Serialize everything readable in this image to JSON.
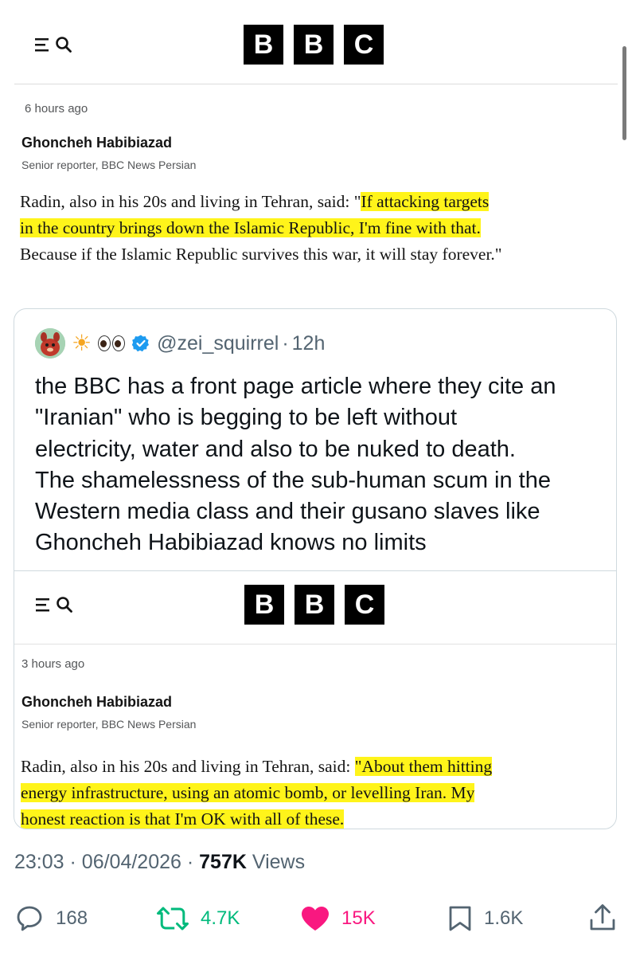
{
  "top_article": {
    "logo_letters": [
      "B",
      "B",
      "C"
    ],
    "timestamp": "6 hours ago",
    "author_name": "Ghoncheh Habibiazad",
    "author_role": "Senior reporter, BBC News Persian",
    "quote_line1_plain": "Radin, also in his 20s and living in Tehran, said: \"",
    "quote_line1_highlight": "If attacking targets",
    "quote_line2_highlight": "in the country brings down the Islamic Republic, I'm fine with that.",
    "quote_line3_plain": "Because if the Islamic Republic survives this war, it will stay forever.\""
  },
  "quoted_tweet": {
    "display_name_emoji": "☀️ 👀",
    "handle": "@zei_squirrel",
    "separator": "·",
    "age": "12h",
    "text_lines": [
      "the BBC has a front page article where they cite an",
      "\"Iranian\" who is begging to be left without",
      "electricity, water and also to be nuked to death.",
      "The shamelessness of the sub-human scum in the",
      "Western media class and their gusano slaves like",
      "Ghoncheh Habibiazad knows no limits"
    ],
    "inner_article": {
      "logo_letters": [
        "B",
        "B",
        "C"
      ],
      "timestamp": "3 hours ago",
      "author_name": "Ghoncheh Habibiazad",
      "author_role": "Senior reporter, BBC News Persian",
      "quote_line1_plain": "Radin, also in his 20s and living in Tehran, said: ",
      "quote_line1_highlight": "\"About them hitting",
      "quote_line2_highlight": "energy infrastructure, using an atomic bomb, or levelling Iran. My",
      "quote_line3_highlight": "honest reaction is that I'm OK with all of these."
    }
  },
  "meta": {
    "time": "23:03",
    "separator": "·",
    "date": "06/04/2026",
    "views_count": "757K",
    "views_label": "Views"
  },
  "actions": {
    "replies": "168",
    "reposts": "4.7K",
    "likes": "15K",
    "bookmarks": "1.6K"
  },
  "colors": {
    "highlight": "#fff41a",
    "repost_green": "#00ba7c",
    "like_pink": "#f91880",
    "verified_blue": "#1d9bf0",
    "muted_text": "#536471"
  },
  "icons": [
    "menu-icon",
    "search-icon",
    "verified-badge-icon",
    "reply-icon",
    "repost-icon",
    "like-icon",
    "bookmark-icon",
    "share-icon"
  ]
}
